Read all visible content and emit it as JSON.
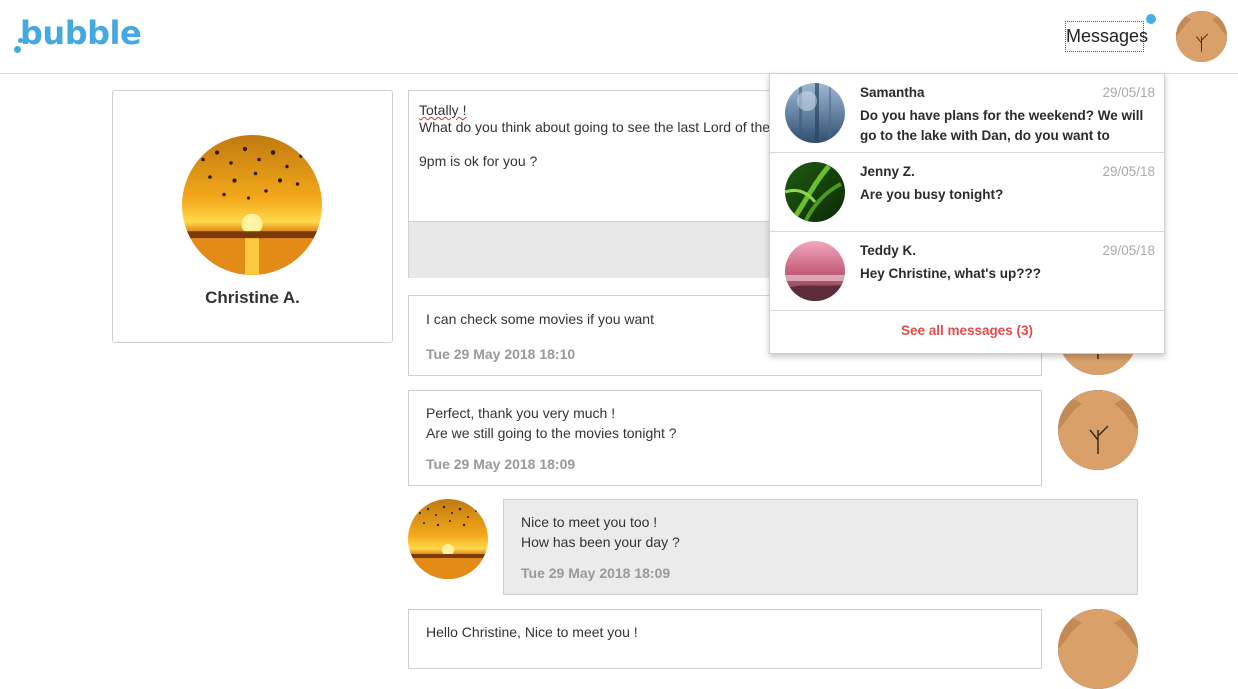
{
  "header": {
    "logo": "bubble",
    "messages_label": "Messages",
    "brand_color": "#46a8e0",
    "notification_color": "#4aaee6"
  },
  "profile": {
    "name": "Christine A."
  },
  "composer": {
    "line1": "Totally !",
    "line2_a": "What do you think about going to see the last Lord of the r",
    "line3": "9pm is ok for you ?"
  },
  "messages": [
    {
      "text": "I can check some movies if you want",
      "timestamp": "Tue 29 May 2018 18:10"
    },
    {
      "text": "Perfect, thank you very much !\nAre we still going to the movies tonight ?",
      "timestamp": "Tue 29 May 2018 18:09"
    },
    {
      "text": "Nice to meet you too !\nHow has been your day ?",
      "timestamp": "Tue 29 May 2018 18:09"
    },
    {
      "text": "Hello Christine, Nice to meet you !"
    }
  ],
  "dropdown": {
    "items": [
      {
        "name": "Samantha",
        "date": "29/05/18",
        "preview": "Do you have plans for the weekend? We will go to the lake with Dan, do you want to come..."
      },
      {
        "name": "Jenny Z.",
        "date": "29/05/18",
        "preview": "Are you busy tonight?"
      },
      {
        "name": "Teddy K.",
        "date": "29/05/18",
        "preview": "Hey Christine, what's up???"
      }
    ],
    "see_all": "See all messages (3)",
    "see_all_color": "#e84a4a"
  }
}
